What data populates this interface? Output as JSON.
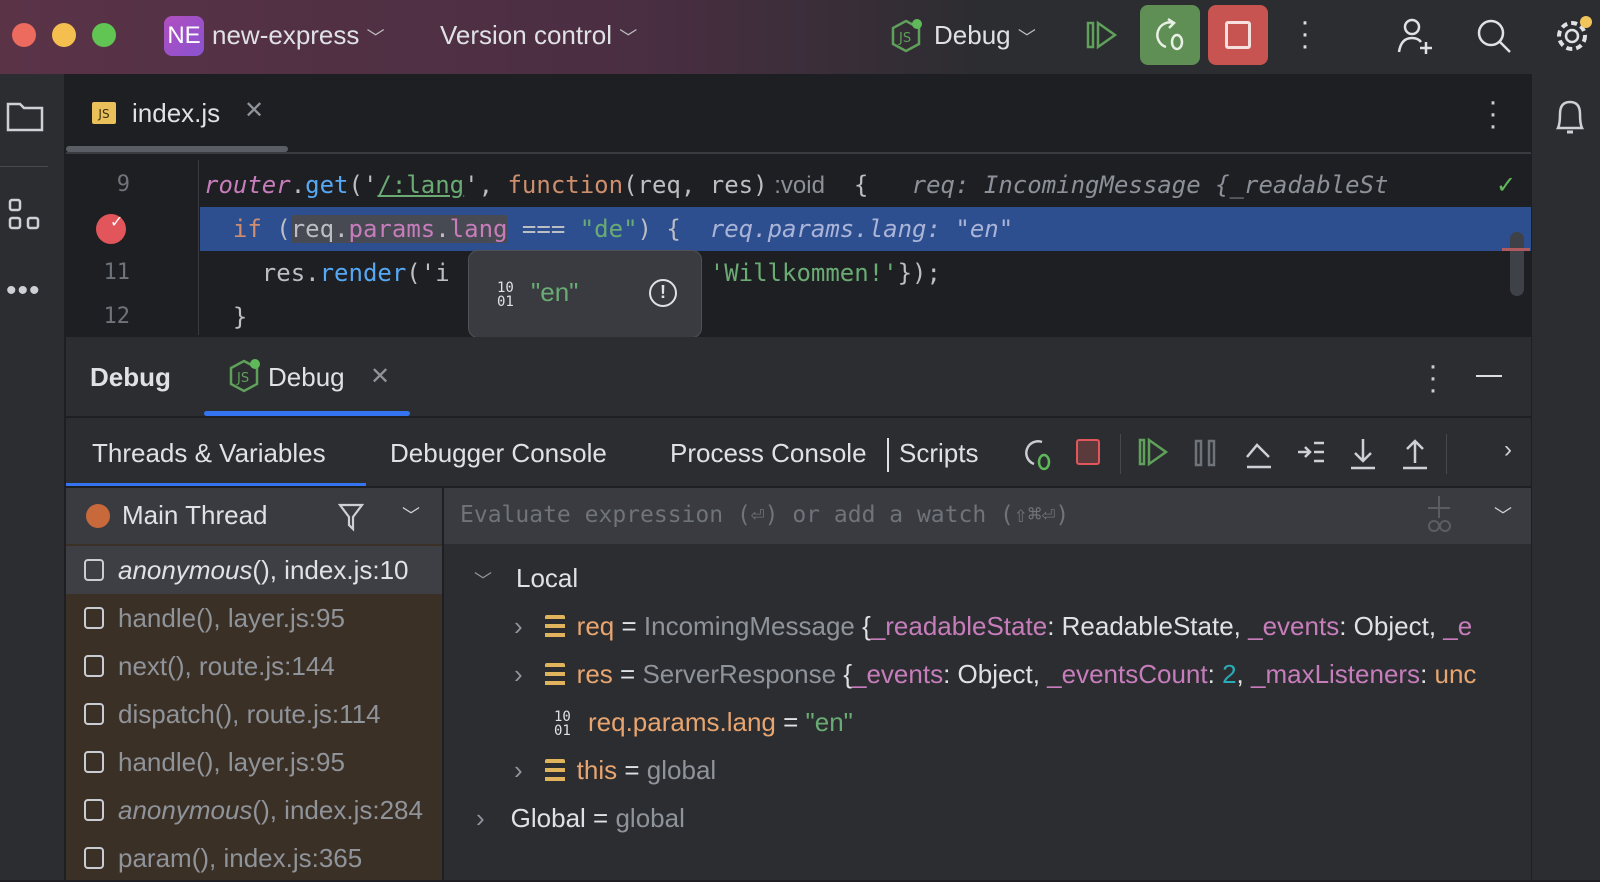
{
  "titlebar": {
    "project_badge": "NE",
    "project_name": "new-express",
    "vcs": "Version control",
    "run_config": "Debug",
    "colors": {
      "rerun_bg": "#5f8f55",
      "stop_bg": "#c75450"
    }
  },
  "editor": {
    "tab": {
      "icon_label": "JS",
      "name": "index.js"
    },
    "lines": [
      {
        "num": "9",
        "tokens": [
          [
            "router",
            "i"
          ],
          [
            ".",
            "d"
          ],
          [
            "get",
            "m"
          ],
          [
            "('",
            "d"
          ],
          [
            "/:lang",
            "s u"
          ],
          [
            "', ",
            "d"
          ],
          [
            "function",
            "k"
          ],
          [
            "(req, res)",
            "d"
          ],
          [
            " :void",
            "t"
          ],
          [
            "  {   ",
            "d"
          ],
          [
            "req: IncomingMessage {_readableSt",
            "h"
          ]
        ]
      },
      {
        "num": "",
        "tokens": [
          [
            "  ",
            "d"
          ],
          [
            "if",
            "k"
          ],
          [
            " (",
            "d"
          ],
          [
            "req.",
            "d sel"
          ],
          [
            "params",
            "p sel"
          ],
          [
            ".",
            "d sel"
          ],
          [
            "lang",
            "p sel"
          ],
          [
            " === ",
            "d"
          ],
          [
            "\"de\"",
            "s"
          ],
          [
            ") {  ",
            "d"
          ],
          [
            "req.params.lang: \"en\"",
            "hb"
          ]
        ]
      },
      {
        "num": "11",
        "tokens": [
          [
            "    res.",
            "d"
          ],
          [
            "render",
            "m"
          ],
          [
            "('i",
            "d"
          ],
          [
            "                  ",
            "d"
          ],
          [
            "'Willkommen!'",
            "s"
          ],
          [
            "});",
            "d"
          ]
        ]
      },
      {
        "num": "12",
        "tokens": [
          [
            "  }",
            "d"
          ]
        ]
      }
    ],
    "tooltip": {
      "value": "\"en\"",
      "type_icon": "10/01"
    }
  },
  "debug": {
    "title": "Debug",
    "session_tab": "Debug",
    "subtabs": [
      "Threads & Variables",
      "Debugger Console",
      "Process Console",
      "Scripts"
    ],
    "thread": "Main Thread",
    "evaluate_placeholder": "Evaluate expression (⏎) or add a watch (⇧⌘⏎)",
    "frames": [
      {
        "fn": "anonymous",
        "rest": "(), index.js:10",
        "italic": true
      },
      {
        "fn": "handle",
        "rest": "(), layer.js:95"
      },
      {
        "fn": "next",
        "rest": "(), route.js:144"
      },
      {
        "fn": "dispatch",
        "rest": "(), route.js:114"
      },
      {
        "fn": "handle",
        "rest": "(), layer.js:95"
      },
      {
        "fn": "anonymous",
        "rest": "(), index.js:284",
        "italic": true
      },
      {
        "fn": "param",
        "rest": "(), index.js:365"
      }
    ],
    "variables": {
      "local": "Local",
      "req": {
        "name": "req",
        "eq": " = ",
        "type": "IncomingMessage ",
        "b": "{",
        "k1": "_readableState",
        "c1": ": ",
        "v1": "ReadableState",
        "s1": ", ",
        "k2": "_events",
        "c2": ": ",
        "v2": "Object",
        "s2": ", ",
        "k3": "_e"
      },
      "res": {
        "name": "res",
        "eq": " = ",
        "type": "ServerResponse ",
        "b": "{",
        "k1": "_events",
        "c1": ": ",
        "v1": "Object",
        "s1": ", ",
        "k2": "_eventsCount",
        "c2": ": ",
        "v2": "2",
        "s2": ", ",
        "k3": "_maxListeners",
        "c3": ": ",
        "v3": "unc"
      },
      "lang": {
        "name": "req.params.lang",
        "eq": " = ",
        "value": "\"en\""
      },
      "this": {
        "name": "this",
        "eq": " = ",
        "value": "global"
      },
      "global": {
        "name": "Global",
        "eq": " = ",
        "value": "global"
      }
    }
  }
}
